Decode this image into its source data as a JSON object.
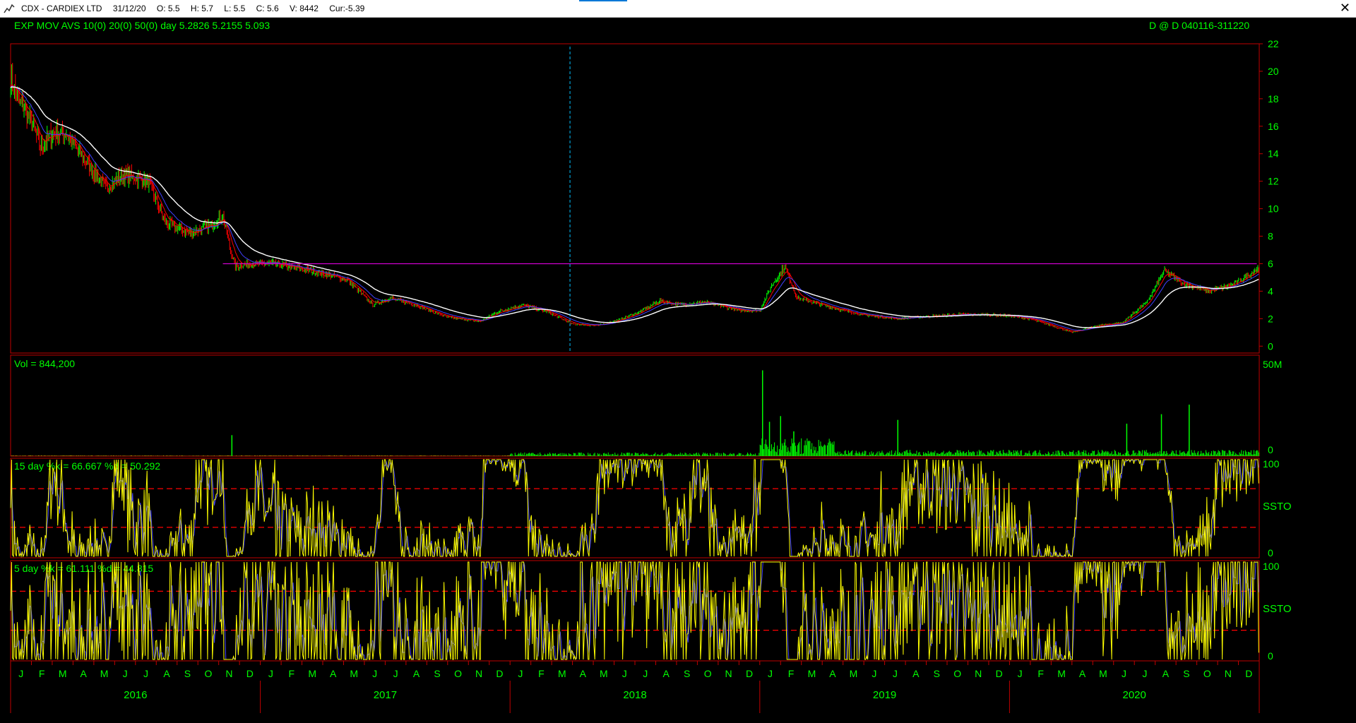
{
  "window": {
    "app_icon": "chart-app-icon",
    "title_parts": [
      "CDX - CARDIEX LTD",
      "31/12/20",
      "O: 5.5",
      "H: 5.7",
      "L: 5.5",
      "C: 5.6",
      "V: 8442",
      "Cur:-5.39"
    ],
    "close_label": "✕"
  },
  "headers": {
    "price_left": "EXP MOV AVS 10(0) 20(0) 50(0)  day     5.2826  5.2155  5.093",
    "price_right": "D @ D   040116-311220",
    "volume": "Vol = 844,200",
    "stoch15": "15 day   %k = 66.667   %d = 50.292",
    "stoch5": "5 day   %k = 61.111   %d = 44.815",
    "ssto_label": "SSTO"
  },
  "colors": {
    "axis": "#00ff00",
    "border": "#c00000",
    "up_bar": "#00ff00",
    "down_bar": "#ff0000",
    "ema10": "#ff0000",
    "ema20": "#4040ff",
    "ema50": "#ffffff",
    "resistance": "#d000d0",
    "cursor": "#00c0ff",
    "stoch_k": "#ffff00",
    "stoch_d": "#4040ff",
    "stoch_ref": "#ff0000"
  },
  "chart_data": [
    {
      "type": "line",
      "panel": "price",
      "ylim": [
        -0.5,
        22
      ],
      "y_ticks": [
        0,
        2,
        4,
        6,
        8,
        10,
        12,
        14,
        16,
        18,
        20,
        22
      ],
      "resistance_level": 6.0,
      "cursor_date": "2018-04",
      "price_path": {
        "x": [
          2016.0,
          2016.03,
          2016.08,
          2016.12,
          2016.17,
          2016.22,
          2016.3,
          2016.38,
          2016.45,
          2016.55,
          2016.62,
          2016.72,
          2016.8,
          2016.85,
          2016.88,
          2016.9,
          2016.96,
          2017.05,
          2017.2,
          2017.35,
          2017.45,
          2017.52,
          2017.62,
          2017.75,
          2017.88,
          2017.95,
          2018.05,
          2018.15,
          2018.25,
          2018.35,
          2018.45,
          2018.52,
          2018.6,
          2018.68,
          2018.78,
          2018.92,
          2019.0,
          2019.05,
          2019.1,
          2019.15,
          2019.25,
          2019.4,
          2019.55,
          2019.7,
          2019.8,
          2019.9,
          2020.0,
          2020.08,
          2020.15,
          2020.25,
          2020.35,
          2020.45,
          2020.55,
          2020.62,
          2020.7,
          2020.8,
          2020.9,
          2020.99
        ],
        "y": [
          19.5,
          18.0,
          16.5,
          14.5,
          15.5,
          15.5,
          13.5,
          11.5,
          12.5,
          12.0,
          9.0,
          8.2,
          8.8,
          9.5,
          7.0,
          5.8,
          6.0,
          6.0,
          5.5,
          4.8,
          3.0,
          3.5,
          3.0,
          2.1,
          1.8,
          2.5,
          3.0,
          2.5,
          1.6,
          1.5,
          2.0,
          2.5,
          3.3,
          3.0,
          3.2,
          2.6,
          2.6,
          4.5,
          5.8,
          3.5,
          3.0,
          2.3,
          2.0,
          2.2,
          2.3,
          2.3,
          2.2,
          2.0,
          1.6,
          1.0,
          1.5,
          1.7,
          3.2,
          5.5,
          4.5,
          4.0,
          4.5,
          5.6
        ]
      },
      "series": [
        {
          "name": "EXP MOV AVS 10(0)",
          "last": 5.2826
        },
        {
          "name": "20(0)",
          "last": 5.2155
        },
        {
          "name": "50(0)",
          "last": 5.093
        }
      ]
    },
    {
      "type": "bar",
      "panel": "volume",
      "y_ticks": [
        "50M",
        "0"
      ],
      "ylim": [
        0,
        50000000
      ],
      "spikes": [
        {
          "date": "2016-11-20",
          "value": 11000000
        },
        {
          "date": "2019-01-05",
          "value": 45000000
        },
        {
          "date": "2019-01-15",
          "value": 18000000
        },
        {
          "date": "2019-02-01",
          "value": 21000000
        },
        {
          "date": "2019-02-20",
          "value": 13000000
        },
        {
          "date": "2019-07-20",
          "value": 19000000
        },
        {
          "date": "2020-06-20",
          "value": 17000000
        },
        {
          "date": "2020-08-10",
          "value": 22000000
        },
        {
          "date": "2020-09-20",
          "value": 27000000
        }
      ],
      "last": 844200
    },
    {
      "type": "line",
      "panel": "stochastic",
      "period_days": 15,
      "ylim": [
        0,
        100
      ],
      "y_ticks": [
        100,
        0
      ],
      "ref_lines": [
        70,
        30
      ],
      "k_last": 66.667,
      "d_last": 50.292
    },
    {
      "type": "line",
      "panel": "stochastic",
      "period_days": 5,
      "ylim": [
        0,
        100
      ],
      "y_ticks": [
        100,
        0
      ],
      "ref_lines": [
        70,
        30
      ],
      "k_last": 61.111,
      "d_last": 44.815
    }
  ],
  "x_axis": {
    "month_labels": [
      "J",
      "F",
      "M",
      "A",
      "M",
      "J",
      "J",
      "A",
      "S",
      "O",
      "N",
      "D"
    ],
    "years": [
      "2016",
      "2017",
      "2018",
      "2019",
      "2020"
    ]
  }
}
